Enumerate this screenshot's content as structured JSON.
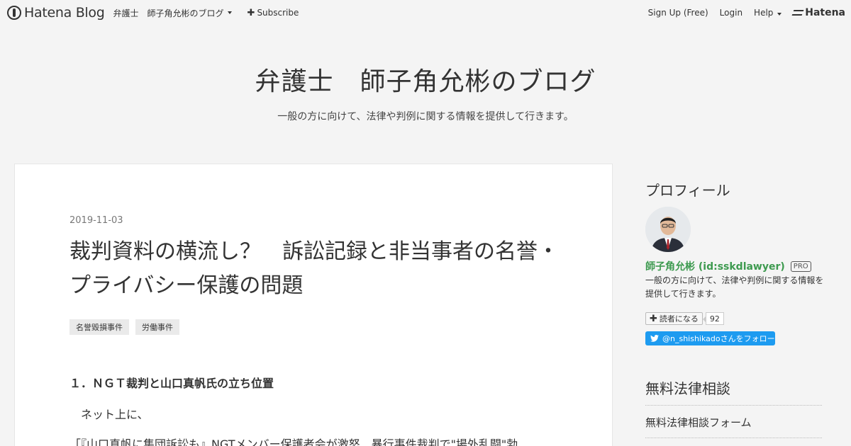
{
  "globalheader": {
    "logo_text": "Hatena Blog",
    "link_lawyer": "弁護士",
    "blog_menu": "師子角允彬のブログ",
    "subscribe": "Subscribe",
    "signup": "Sign Up (Free)",
    "login": "Login",
    "help": "Help",
    "hatena": "Hatena"
  },
  "blog": {
    "title": "弁護士　師子角允彬のブログ",
    "description": "一般の方に向けて、法律や判例に関する情報を提供して行きます。"
  },
  "entry": {
    "date": "2019-11-03",
    "title": "裁判資料の横流し？　訴訟記録と非当事者の名誉・プライバシー保護の問題",
    "categories": [
      "名誉毀損事件",
      "労働事件"
    ],
    "heading": "１．ＮＧＴ裁判と山口真帆氏の立ち位置",
    "para1": "　ネット上に、",
    "para2": "「『山口真帆に集団訴訟も』NGTメンバー保護者会が激怒　暴行事件裁判で\"場外乱闘\"勃"
  },
  "sidebar": {
    "profile_title": "プロフィール",
    "name": "師子角允彬 (id:sskdlawyer)",
    "pro_badge": "PRO",
    "description": "一般の方に向けて、法律や判例に関する情報を提供して行きます。",
    "reader_button": "読者になる",
    "reader_count": "92",
    "twitter_follow": "@n_shishikadoさんをフォロー",
    "section2_title": "無料法律相談",
    "section2_link": "無料法律相談フォーム"
  }
}
